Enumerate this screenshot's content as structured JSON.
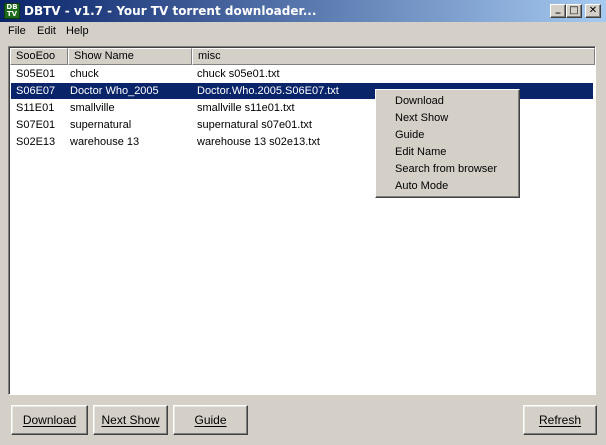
{
  "window": {
    "title": "DBTV - v1.7 - Your TV torrent downloader...",
    "icon_text": "DB\nTV",
    "controls": {
      "minimize": "_",
      "maximize": "□",
      "close": "✕"
    }
  },
  "menu": [
    "File",
    "Edit",
    "Help"
  ],
  "table": {
    "columns": [
      "SooEoo",
      "Show Name",
      "misc"
    ],
    "rows": [
      {
        "episode": "S05E01",
        "show": "chuck",
        "misc": "chuck s05e01.txt"
      },
      {
        "episode": "S06E07",
        "show": "Doctor Who_2005",
        "misc": "Doctor.Who.2005.S06E07.txt"
      },
      {
        "episode": "S11E01",
        "show": "smallville",
        "misc": "smallville s11e01.txt"
      },
      {
        "episode": "S07E01",
        "show": "supernatural",
        "misc": "supernatural s07e01.txt"
      },
      {
        "episode": "S02E13",
        "show": "warehouse 13",
        "misc": "warehouse 13 s02e13.txt"
      }
    ],
    "selected_row": 1
  },
  "context_menu": [
    "Download",
    "Next Show",
    "Guide",
    "Edit Name",
    "Search from browser",
    "Auto Mode"
  ],
  "buttons": {
    "download": "Download",
    "next_show": "Next Show",
    "guide": "Guide",
    "refresh": "Refresh"
  }
}
